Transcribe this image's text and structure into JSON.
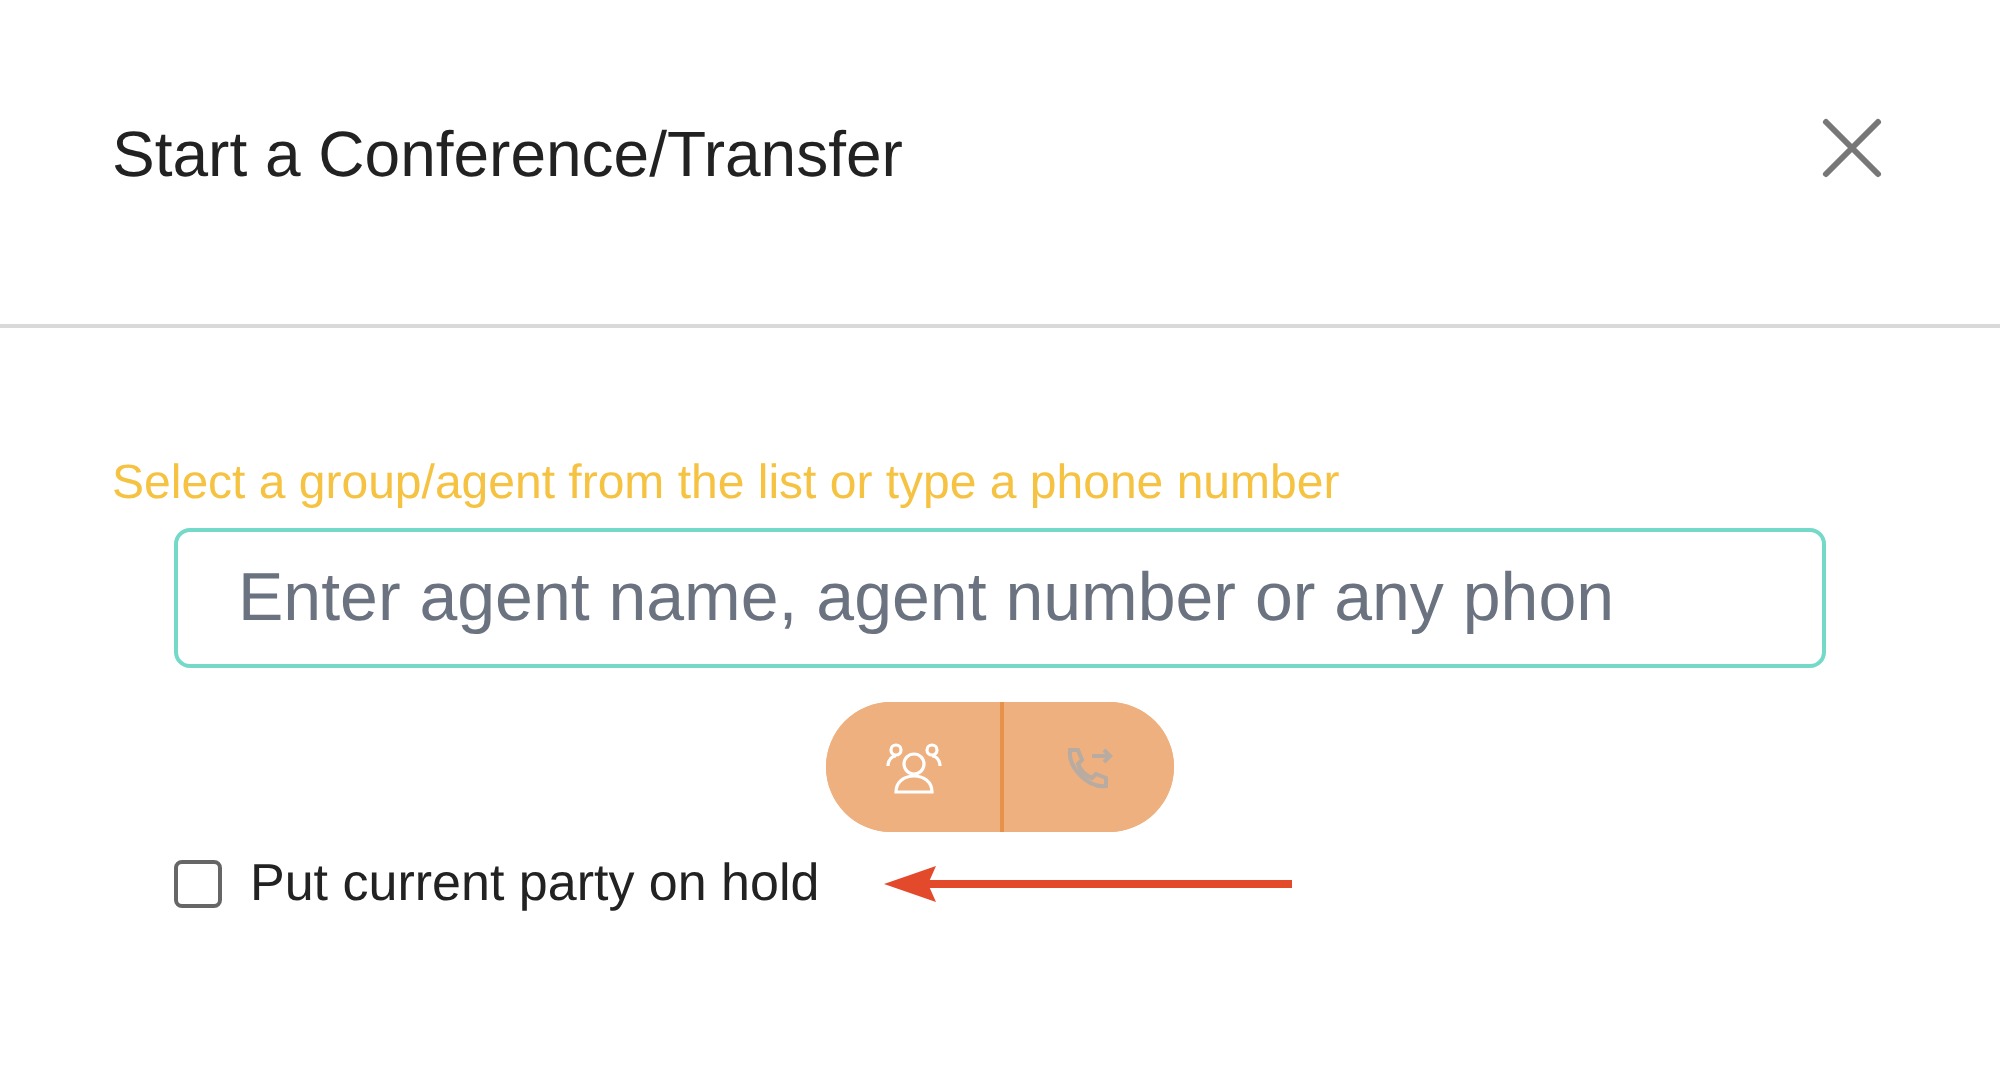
{
  "dialog": {
    "title": "Start a Conference/Transfer"
  },
  "prompt": "Select a group/agent from the list or type a phone number",
  "search": {
    "placeholder": "Enter agent name, agent number or any phon"
  },
  "actions": [
    {
      "kind": "conference",
      "disabled": false
    },
    {
      "kind": "transfer",
      "disabled": true
    }
  ],
  "hold": {
    "label": "Put current party on hold",
    "checked": false
  }
}
